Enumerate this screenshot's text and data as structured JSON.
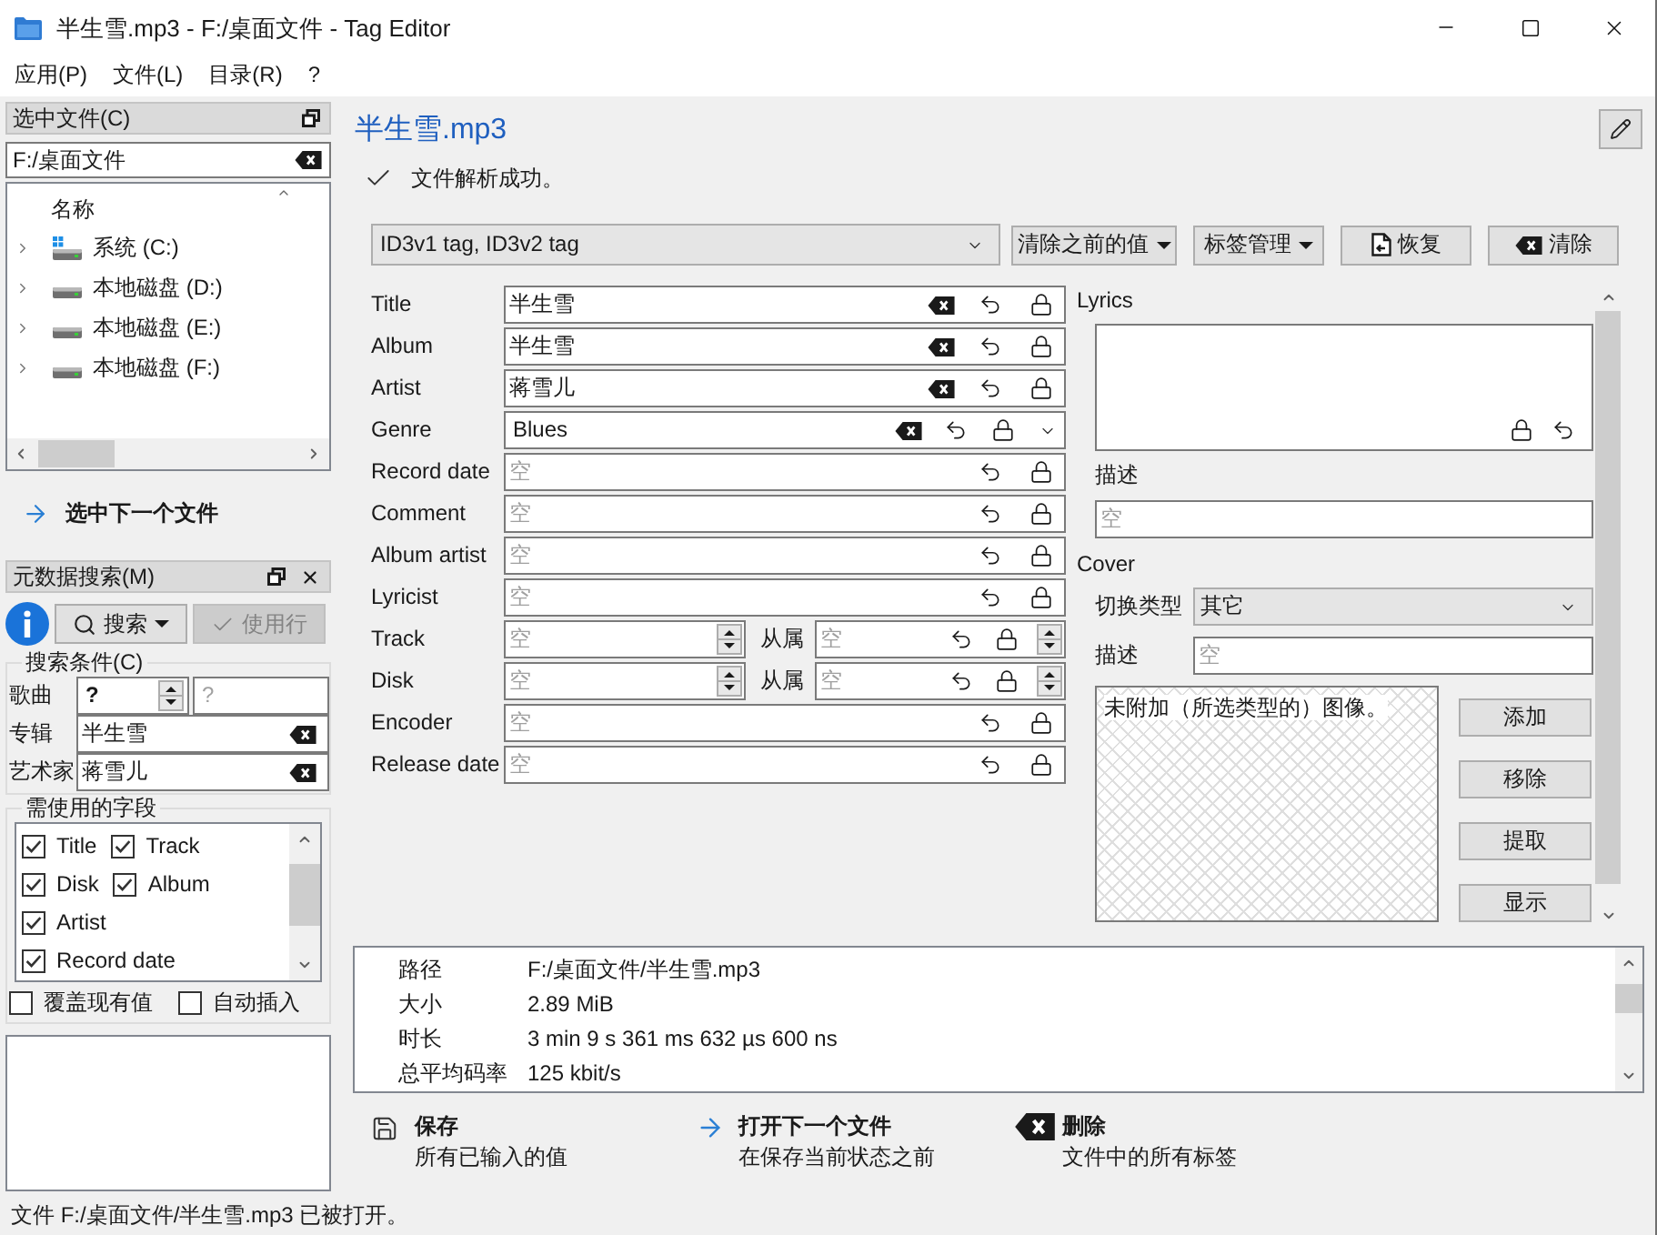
{
  "window": {
    "title": "半生雪.mp3 - F:/桌面文件 - Tag Editor"
  },
  "menu": [
    "应用(P)",
    "文件(L)",
    "目录(R)",
    "?"
  ],
  "file_dock": {
    "title": "选中文件(C)",
    "path": "F:/桌面文件",
    "column": "名称",
    "drives": [
      {
        "label": "系统 (C:)",
        "kind": "system",
        "expanded": false
      },
      {
        "label": "本地磁盘 (D:)",
        "kind": "disk",
        "expanded": false
      },
      {
        "label": "本地磁盘 (E:)",
        "kind": "disk",
        "expanded": false
      },
      {
        "label": "本地磁盘 (F:)",
        "kind": "disk",
        "expanded": false
      }
    ],
    "next_file": "选中下一个文件"
  },
  "search_dock": {
    "title": "元数据搜索(M)",
    "search_button": "搜索",
    "use_row": {
      "label": "使用行",
      "disabled": true
    },
    "criteria_title": "搜索条件(C)",
    "criteria": [
      {
        "label": "歌曲",
        "kind": "number",
        "value": "?",
        "placeholder": "?"
      },
      {
        "label": "专辑",
        "kind": "text",
        "value": "半生雪"
      },
      {
        "label": "艺术家",
        "kind": "text",
        "value": "蒋雪儿"
      }
    ],
    "fields_title": "需使用的字段",
    "fields": [
      {
        "label": "Title",
        "checked": true
      },
      {
        "label": "Track",
        "checked": true
      },
      {
        "label": "Disk",
        "checked": true
      },
      {
        "label": "Album",
        "checked": true
      },
      {
        "label": "Artist",
        "checked": true
      },
      {
        "label": "Record date",
        "checked": true
      }
    ],
    "options": [
      {
        "label": "覆盖现有值",
        "checked": false
      },
      {
        "label": "自动插入",
        "checked": false
      }
    ]
  },
  "editor": {
    "file_name": "半生雪.mp3",
    "status": "文件解析成功。",
    "tag_select": "ID3v1 tag, ID3v2 tag",
    "buttons": [
      {
        "label": "清除之前的值",
        "kind": "menu"
      },
      {
        "label": "标签管理",
        "kind": "menu"
      },
      {
        "label": "恢复",
        "kind": "restore"
      },
      {
        "label": "清除",
        "kind": "clear"
      }
    ],
    "fields": [
      {
        "label": "Title",
        "kind": "text",
        "value": "半生雪"
      },
      {
        "label": "Album",
        "kind": "text",
        "value": "半生雪"
      },
      {
        "label": "Artist",
        "kind": "text",
        "value": "蒋雪儿"
      },
      {
        "label": "Genre",
        "kind": "combo",
        "value": "Blues"
      },
      {
        "label": "Record date",
        "kind": "text",
        "placeholder": "空"
      },
      {
        "label": "Comment",
        "kind": "text",
        "placeholder": "空"
      },
      {
        "label": "Album artist",
        "kind": "text",
        "placeholder": "空"
      },
      {
        "label": "Lyricist",
        "kind": "text",
        "placeholder": "空"
      },
      {
        "label": "Track",
        "kind": "pair",
        "placeholder": "空",
        "of_label": "从属",
        "of_placeholder": "空"
      },
      {
        "label": "Disk",
        "kind": "pair",
        "placeholder": "空",
        "of_label": "从属",
        "of_placeholder": "空"
      },
      {
        "label": "Encoder",
        "kind": "text",
        "placeholder": "空"
      },
      {
        "label": "Release date",
        "kind": "text",
        "placeholder": "空"
      }
    ],
    "lyrics": {
      "label": "Lyrics",
      "description_label": "描述",
      "description_placeholder": "空"
    },
    "cover": {
      "label": "Cover",
      "type_label": "切换类型",
      "type_value": "其它",
      "description_label": "描述",
      "description_placeholder": "空",
      "image_message": "未附加（所选类型的）图像。",
      "buttons": [
        "添加",
        "移除",
        "提取",
        "显示"
      ]
    },
    "file_info": [
      {
        "label": "路径",
        "value": "F:/桌面文件/半生雪.mp3"
      },
      {
        "label": "大小",
        "value": "2.89 MiB"
      },
      {
        "label": "时长",
        "value": "3 min 9 s 361 ms 632 µs 600 ns"
      },
      {
        "label": "总平均码率",
        "value": "125 kbit/s"
      }
    ],
    "actions": [
      {
        "kind": "save",
        "title": "保存",
        "subtitle": "所有已输入的值"
      },
      {
        "kind": "next",
        "title": "打开下一个文件",
        "subtitle": "在保存当前状态之前"
      },
      {
        "kind": "delete",
        "title": "删除",
        "subtitle": "文件中的所有标签"
      }
    ]
  },
  "status_bar": "文件 F:/桌面文件/半生雪.mp3 已被打开。"
}
